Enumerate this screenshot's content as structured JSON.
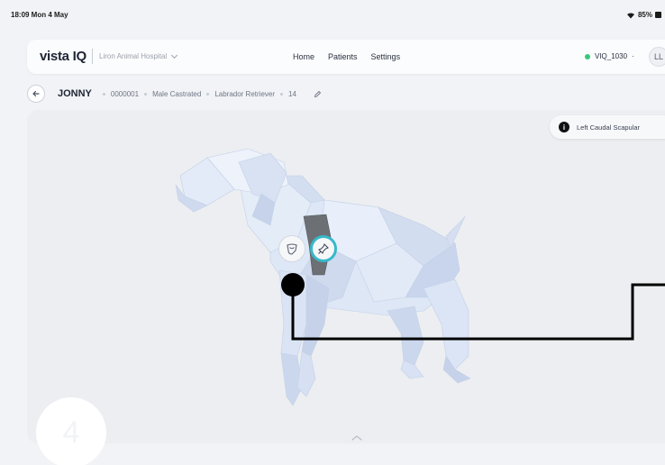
{
  "status": {
    "time": "18:09  Mon 4 May",
    "battery": "85%"
  },
  "nav": {
    "logo": "vista",
    "logo_iq": "IQ",
    "hospital": "Liron Animal Hospital",
    "links": [
      "Home",
      "Patients",
      "Settings"
    ],
    "device": "VIQ_1030",
    "device_sep": "·",
    "avatar": "LL"
  },
  "patient": {
    "name": "JONNY",
    "id": "0000001",
    "sex": "Male Castrated",
    "breed": "Labrador Retriever",
    "age": "14"
  },
  "viewer": {
    "location_label": "Left Caudal Scapular",
    "info_glyph": "i",
    "count": "4"
  },
  "colors": {
    "accent": "#36b8c9",
    "online": "#37c87a",
    "dog": "#dce6f5"
  },
  "icons": [
    "back-arrow-icon",
    "edit-pencil-icon",
    "heart-shield-icon",
    "pin-icon",
    "chevron-up-icon",
    "info-icon",
    "wifi-icon",
    "battery-icon"
  ]
}
